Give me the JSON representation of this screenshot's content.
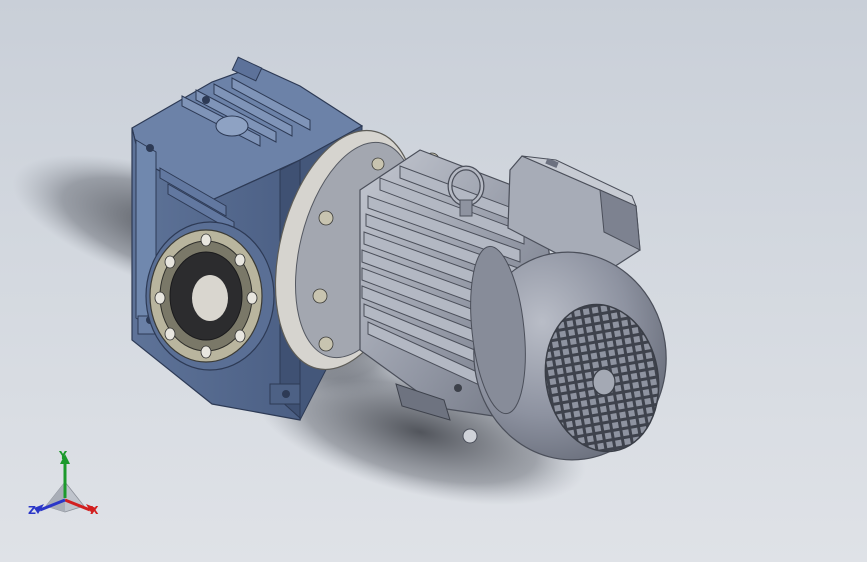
{
  "viewport": {
    "background_top": "#c9cfd8",
    "background_bottom": "#dfe2e7"
  },
  "model": {
    "gearbox_color": "#5a6f95",
    "motor_color": "#9aa0ad",
    "flange_color": "#d6d4cf"
  },
  "triad": {
    "y_label": "Y",
    "x_label": "X",
    "z_label": "Z",
    "y_color": "#1c9a2c",
    "x_color": "#d21f1f",
    "z_color": "#2a36c8"
  }
}
